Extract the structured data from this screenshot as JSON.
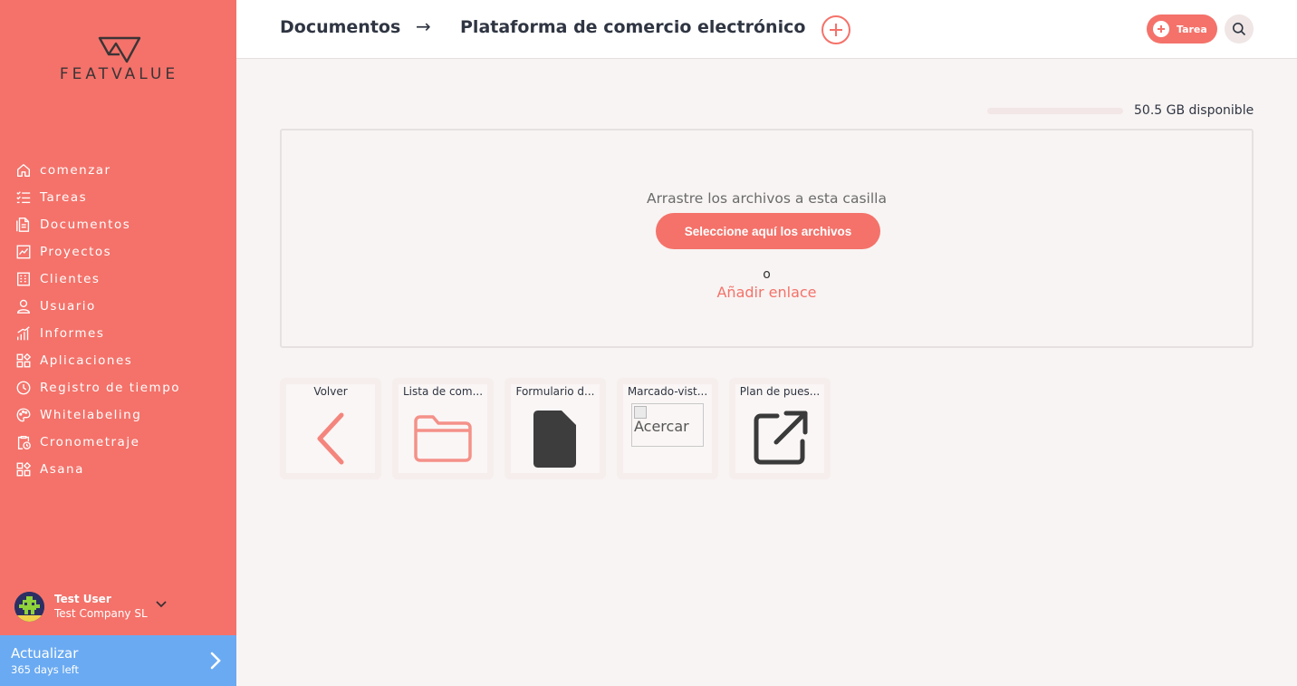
{
  "brand": {
    "name": "FEATVALUE"
  },
  "sidebar": {
    "items": [
      {
        "label": "comenzar",
        "icon": "home-icon"
      },
      {
        "label": "Tareas",
        "icon": "task-list-icon"
      },
      {
        "label": "Documentos",
        "icon": "document-icon"
      },
      {
        "label": "Proyectos",
        "icon": "projects-chart-icon"
      },
      {
        "label": "Clientes",
        "icon": "building-icon"
      },
      {
        "label": "Usuario",
        "icon": "user-icon"
      },
      {
        "label": "Informes",
        "icon": "reports-bar-icon"
      },
      {
        "label": "Aplicaciones",
        "icon": "apps-grid-icon"
      },
      {
        "label": "Registro de tiempo",
        "icon": "timer-icon"
      },
      {
        "label": "Whitelabeling",
        "icon": "palette-icon"
      },
      {
        "label": "Cronometraje",
        "icon": "clipboard-clock-icon"
      },
      {
        "label": "Asana",
        "icon": "apps-grid-icon"
      }
    ]
  },
  "user": {
    "name": "Test User",
    "company": "Test Company SL"
  },
  "upgrade": {
    "title": "Actualizar",
    "subtitle": "365 days left"
  },
  "header": {
    "crumb_root": "Documentos",
    "crumb_arrow": "→",
    "crumb_current": "Plataforma de comercio electrónico",
    "task_label": "Tarea"
  },
  "storage": {
    "text": "50.5 GB disponible"
  },
  "dropzone": {
    "instruction": "Arrastre los archivos a esta casilla",
    "select_button": "Seleccione aquí los archivos",
    "or": "o",
    "add_link": "Añadir enlace"
  },
  "tiles": [
    {
      "label": "Volver",
      "icon": "chevron-left-icon"
    },
    {
      "label": "Lista de com...",
      "icon": "folder-icon"
    },
    {
      "label": "Formulario d...",
      "icon": "file-icon"
    },
    {
      "label": "Marcado-vist...",
      "icon": "broken-image-icon",
      "alt": "Acercar"
    },
    {
      "label": "Plan de pues...",
      "icon": "external-link-icon"
    }
  ],
  "colors": {
    "accent": "#f4726a",
    "upgrade": "#6aaaf2",
    "text": "#2f3542"
  }
}
